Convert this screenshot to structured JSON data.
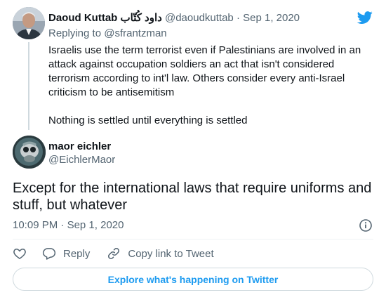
{
  "parent_tweet": {
    "author_name": "Daoud Kuttab داود كُتّاب",
    "handle": "@daoudkuttab",
    "separator": "·",
    "date": "Sep 1, 2020",
    "replying_prefix": "Replying to",
    "replying_to": "@sfrantzman",
    "paragraphs": [
      "Israelis use the term terrorist even if Palestinians are involved in an attack against occupation soldiers an act that isn't considered terrorism according to int'l law. Others consider every anti-Israel criticism to be antisemitism",
      "Nothing is settled until everything is settled"
    ]
  },
  "main_tweet": {
    "author_name": "maor eichler",
    "handle": "@EichlerMaor",
    "text": "Except for the international laws that require uniforms and stuff, but whatever",
    "time": "10:09 PM",
    "separator": "·",
    "date": "Sep 1, 2020"
  },
  "actions": {
    "reply_label": "Reply",
    "copy_link_label": "Copy link to Tweet"
  },
  "explore_label": "Explore what's happening on Twitter",
  "colors": {
    "accent": "#1d9bf0",
    "text": "#0f1419",
    "secondary": "#536471",
    "border": "#cfd9de"
  },
  "icons": [
    "twitter-bird-icon",
    "info-icon",
    "heart-icon",
    "reply-bubble-icon",
    "link-icon"
  ]
}
